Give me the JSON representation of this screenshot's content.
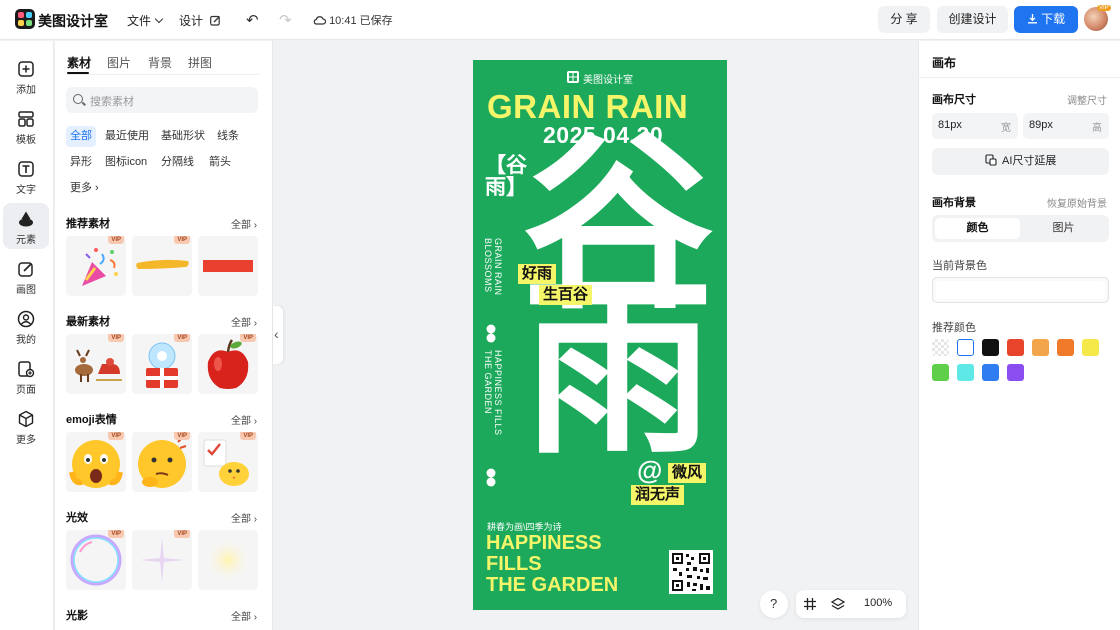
{
  "app": {
    "name": "美图设计室"
  },
  "topbar": {
    "file_menu": "文件",
    "design_menu": "设计",
    "saved_status": "10:41 已保存",
    "share_label": "分 享",
    "create_label": "创建设计",
    "download_label": "下载",
    "avatar_badge": "VIP"
  },
  "leftnav": {
    "items": [
      {
        "label": "添加",
        "icon": "plus-square-icon"
      },
      {
        "label": "模板",
        "icon": "template-icon"
      },
      {
        "label": "文字",
        "icon": "text-icon"
      },
      {
        "label": "元素",
        "icon": "shapes-icon"
      },
      {
        "label": "画图",
        "icon": "draw-icon"
      },
      {
        "label": "我的",
        "icon": "user-icon"
      },
      {
        "label": "页面",
        "icon": "page-add-icon"
      },
      {
        "label": "更多",
        "icon": "cube-icon"
      }
    ],
    "active_index": 3
  },
  "panel": {
    "tabs": [
      "素材",
      "图片",
      "背景",
      "拼图"
    ],
    "search_placeholder": "搜索素材",
    "chips_row1": [
      "全部",
      "最近使用",
      "基础形状",
      "线条"
    ],
    "chips_row2": [
      "异形",
      "图标icon",
      "分隔线",
      "箭头"
    ],
    "more_label": "更多",
    "all_label": "全部",
    "vip_badge": "VIP",
    "sections": [
      {
        "title": "推荐素材",
        "items": [
          "party-popper",
          "yellow-brush-stroke",
          "red-bar"
        ]
      },
      {
        "title": "最新素材",
        "items": [
          "reindeer-sleigh",
          "snowglobe-gift",
          "red-apple"
        ]
      },
      {
        "title": "emoji表情",
        "items": [
          "shocked-emoji",
          "thinking-emoji",
          "checklist-chick"
        ]
      },
      {
        "title": "光效",
        "items": [
          "bubble-ring",
          "light-sparkle",
          "soft-glow"
        ]
      },
      {
        "title": "光影",
        "items": []
      }
    ]
  },
  "poster": {
    "brand": "美图设计室",
    "title_en": "GRAIN RAIN",
    "date": "2025.04.20",
    "side_cn": "【谷雨】",
    "side_en_1": "GRAIN RAIN BLOSSOMS",
    "side_en_2": "HAPPINESS FILLS THE GARDEN",
    "big_char_1": "谷",
    "big_char_2": "雨",
    "tag_1": "好雨",
    "tag_2": "生百谷",
    "tag_3": "微风",
    "tag_4": "润无声",
    "at_symbol": "@",
    "footer_cn": "耕春为画\\四季为诗",
    "footer_en_1": "HAPPINESS",
    "footer_en_2": "FILLS",
    "footer_en_3": "THE GARDEN",
    "colors": {
      "background": "#1da95b",
      "accent": "#f5f56a",
      "text": "#ffffff"
    }
  },
  "canvas_tools": {
    "help": "?",
    "zoom": "100%"
  },
  "rightpanel": {
    "title": "画布",
    "size_label": "画布尺寸",
    "size_link": "调整尺寸",
    "width_value": "81px",
    "width_unit": "宽",
    "height_value": "89px",
    "height_unit": "高",
    "ai_label": "AI尺寸延展",
    "bg_label": "画布背景",
    "bg_link": "恢复原始背景",
    "seg_color": "颜色",
    "seg_image": "图片",
    "current_bg_label": "当前背景色",
    "recommend_label": "推荐颜色",
    "swatches": [
      "transparent",
      "#ffffff",
      "#111111",
      "#e8442c",
      "#f2a54a",
      "#f07a2a",
      "#f5e94a",
      "#5fcf4a",
      "#5ee8e6",
      "#2f7df0",
      "#8a4ef0"
    ]
  }
}
